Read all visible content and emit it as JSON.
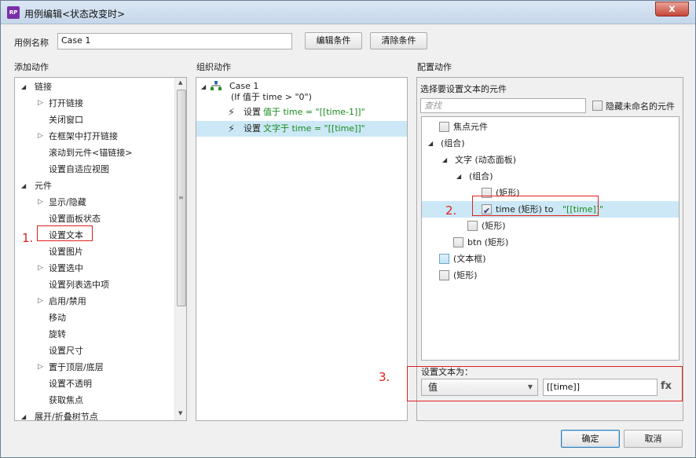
{
  "window": {
    "title": "用例编辑<状态改变时>",
    "app_icon_text": "RP",
    "close_glyph": "x"
  },
  "case_name": {
    "label": "用例名称",
    "value": "Case 1",
    "edit_conditions": "编辑条件",
    "clear_conditions": "清除条件"
  },
  "add_actions": {
    "header": "添加动作",
    "items": [
      {
        "label": "链接",
        "level": 0,
        "arrow": "open"
      },
      {
        "label": "打开链接",
        "level": 1,
        "arrow": "closed"
      },
      {
        "label": "关闭窗口",
        "level": 1,
        "arrow": "none"
      },
      {
        "label": "在框架中打开链接",
        "level": 1,
        "arrow": "closed"
      },
      {
        "label": "滚动到元件<锚链接>",
        "level": 1,
        "arrow": "none"
      },
      {
        "label": "设置自适应视图",
        "level": 1,
        "arrow": "none"
      },
      {
        "label": "元件",
        "level": 0,
        "arrow": "open"
      },
      {
        "label": "显示/隐藏",
        "level": 1,
        "arrow": "closed"
      },
      {
        "label": "设置面板状态",
        "level": 1,
        "arrow": "none"
      },
      {
        "label": "设置文本",
        "level": 1,
        "arrow": "none"
      },
      {
        "label": "设置图片",
        "level": 1,
        "arrow": "none"
      },
      {
        "label": "设置选中",
        "level": 1,
        "arrow": "closed"
      },
      {
        "label": "设置列表选中项",
        "level": 1,
        "arrow": "none"
      },
      {
        "label": "启用/禁用",
        "level": 1,
        "arrow": "closed"
      },
      {
        "label": "移动",
        "level": 1,
        "arrow": "none"
      },
      {
        "label": "旋转",
        "level": 1,
        "arrow": "none"
      },
      {
        "label": "设置尺寸",
        "level": 1,
        "arrow": "none"
      },
      {
        "label": "置于顶层/底层",
        "level": 1,
        "arrow": "closed"
      },
      {
        "label": "设置不透明",
        "level": 1,
        "arrow": "none"
      },
      {
        "label": "获取焦点",
        "level": 1,
        "arrow": "none"
      },
      {
        "label": "展开/折叠树节点",
        "level": 0,
        "arrow": "open"
      }
    ]
  },
  "organize_actions": {
    "header": "组织动作",
    "case_title": "Case 1",
    "case_condition": "(If 值于 time > \"0\")",
    "actions": [
      {
        "verb": "设置",
        "detail": "值于 time = \"[[time-1]]\"",
        "selected": false
      },
      {
        "verb": "设置",
        "detail": "文字于 time = \"[[time]]\"",
        "selected": true
      }
    ]
  },
  "configure_actions": {
    "header": "配置动作",
    "select_widget_label": "选择要设置文本的元件",
    "search_placeholder": "查找",
    "hide_unnamed_label": "隐藏未命名的元件",
    "tree": [
      {
        "label": "焦点元件",
        "checkbox": "unchecked"
      },
      {
        "label": "(组合)",
        "arrow": "open"
      },
      {
        "label": "文字 (动态面板)",
        "arrow": "open"
      },
      {
        "label": "(组合)",
        "arrow": "open"
      },
      {
        "label": "(矩形)",
        "checkbox": "unchecked"
      },
      {
        "label": "time (矩形) to ",
        "value": "\"[[time]]\"",
        "checkbox": "checked"
      },
      {
        "label": "(矩形)",
        "checkbox": "unchecked"
      },
      {
        "label": "btn (矩形)",
        "checkbox": "unchecked"
      },
      {
        "label": "(文本框)",
        "checkbox": "blue"
      },
      {
        "label": "(矩形)",
        "checkbox": "unchecked"
      }
    ],
    "set_text_label": "设置文本为：",
    "type_select_value": "值",
    "value_input": "[[time]]",
    "fx_label": "fx"
  },
  "annotations": [
    "1.",
    "2.",
    "3."
  ],
  "footer": {
    "ok": "确定",
    "cancel": "取消"
  }
}
